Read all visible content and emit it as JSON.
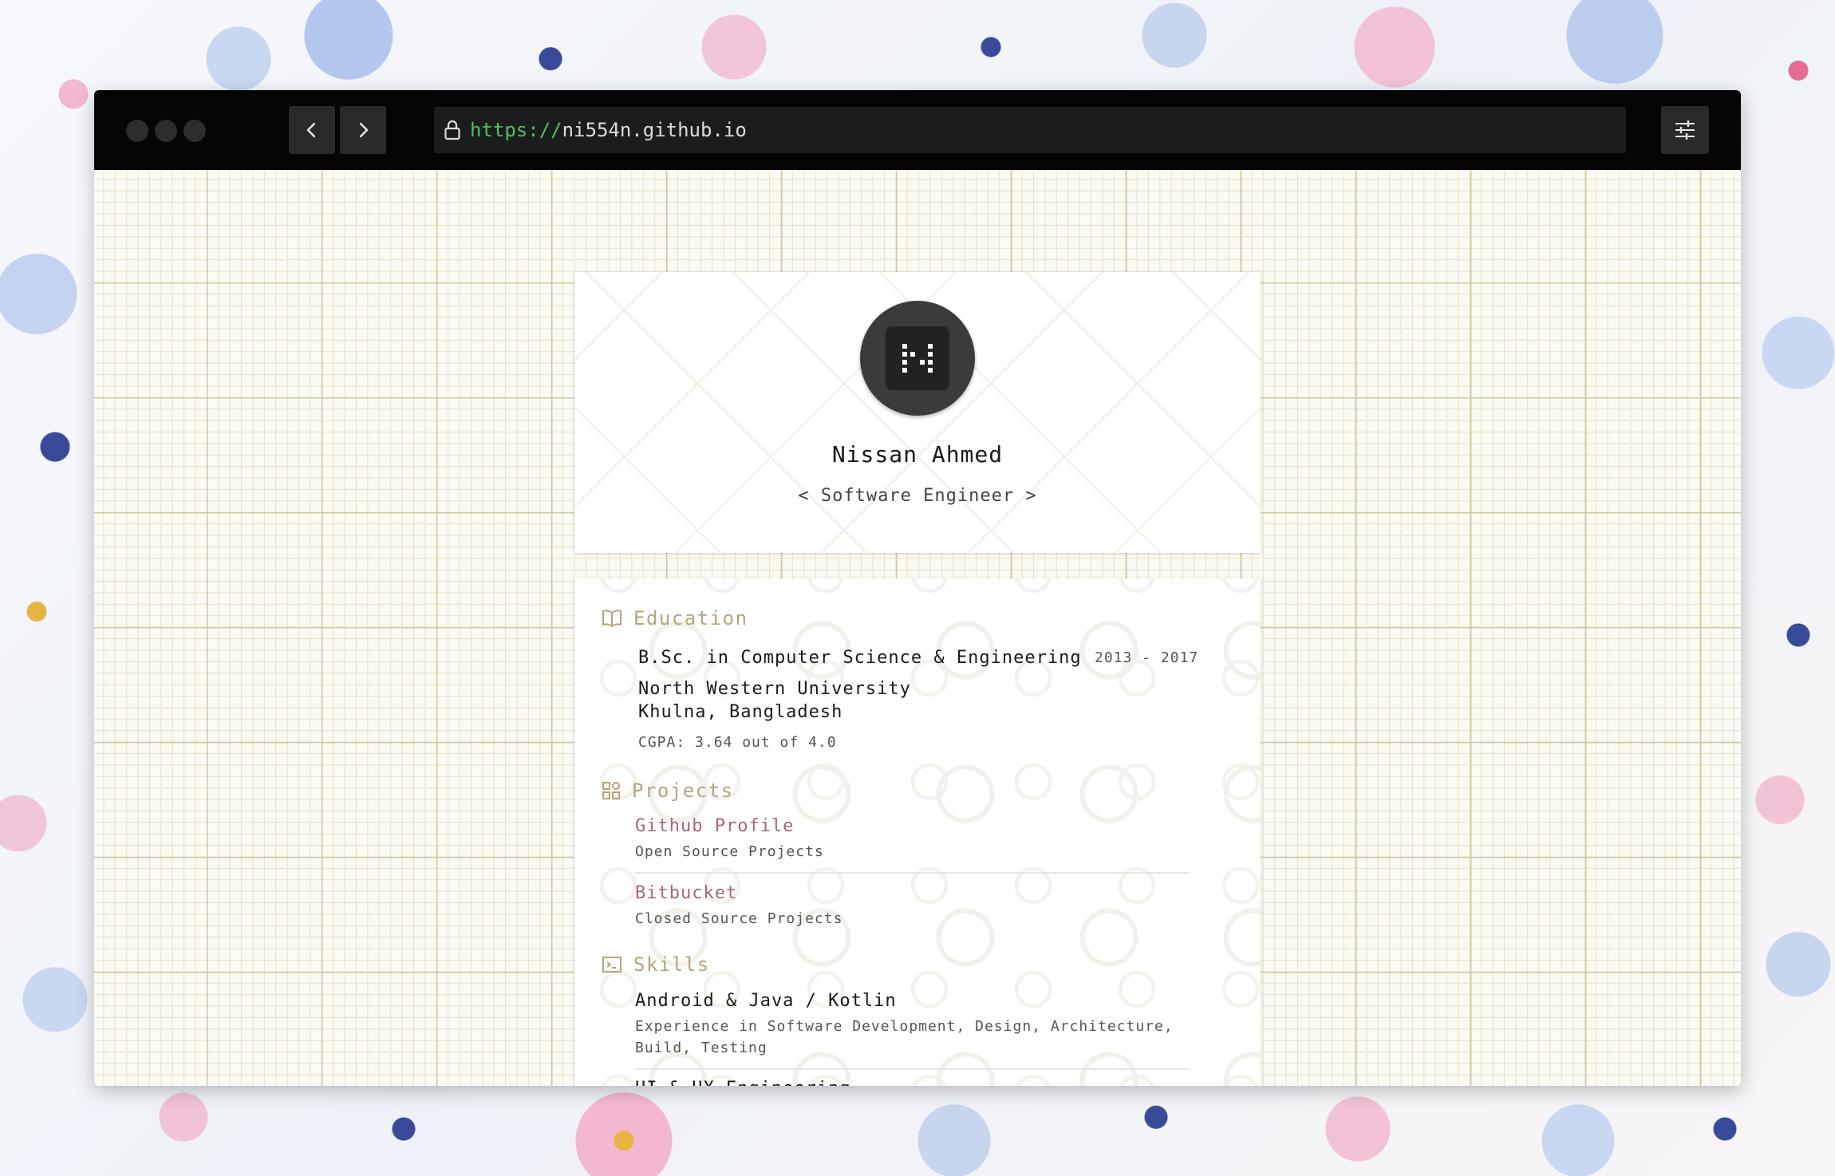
{
  "browser": {
    "url_scheme": "https://",
    "url_host": "ni554n.github.io"
  },
  "profile": {
    "name": "Nissan Ahmed",
    "title": "< Software Engineer >"
  },
  "education": {
    "heading": "Education",
    "degree": "B.Sc. in Computer Science & Engineering",
    "years": "2013 - 2017",
    "university": "North Western University",
    "location": "Khulna, Bangladesh",
    "cgpa": "CGPA: 3.64 out of 4.0"
  },
  "projects": {
    "heading": "Projects",
    "items": [
      {
        "title": "Github Profile",
        "description": "Open Source Projects"
      },
      {
        "title": "Bitbucket",
        "description": "Closed Source Projects"
      }
    ]
  },
  "skills": {
    "heading": "Skills",
    "items": [
      {
        "title": "Android & Java / Kotlin",
        "description_line1": "Experience in Software Development, Design, Architecture,",
        "description_line2": "Build, Testing"
      },
      {
        "title": "UI & UX Engineering"
      }
    ]
  },
  "icons": {
    "lock": "lock-icon",
    "back": "chevron-left-icon",
    "forward": "chevron-right-icon",
    "menu": "sliders-icon",
    "education": "book-icon",
    "projects": "grid-icon",
    "skills": "terminal-icon"
  },
  "colors": {
    "accent": "#b5a57d",
    "link": "#a8687a",
    "url_scheme": "#4fbf62"
  }
}
